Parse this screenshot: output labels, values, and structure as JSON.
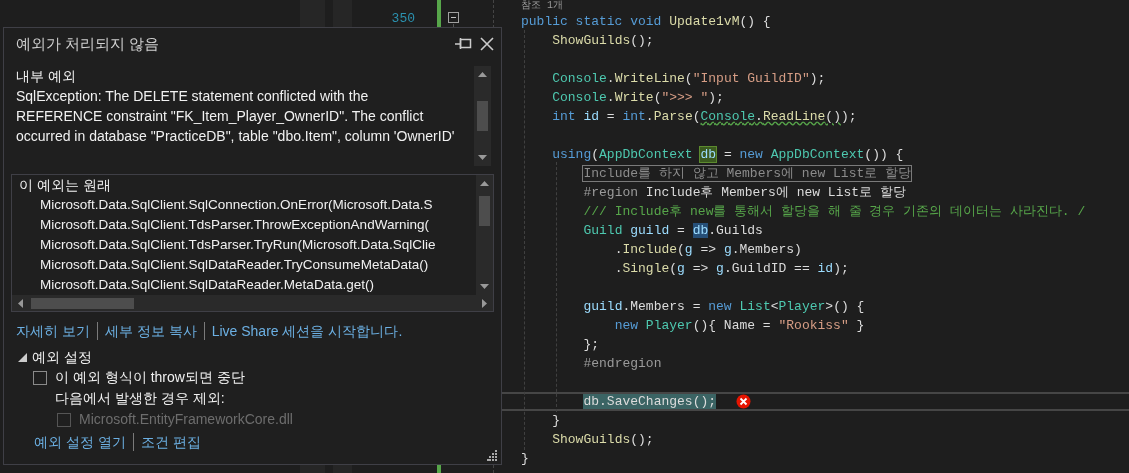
{
  "editor": {
    "line_number": "350",
    "code_lines": [
      {
        "kind": "codelens",
        "text": "참조 1개"
      },
      {
        "kind": "code",
        "tokens": [
          {
            "text": "public static void ",
            "kind": "kw"
          },
          {
            "text": "Update1vM",
            "kind": "method"
          },
          {
            "text": "() {",
            "kind": "plain"
          }
        ]
      },
      {
        "kind": "code",
        "tokens": [
          {
            "text": "    ShowGuilds",
            "kind": "method"
          },
          {
            "text": "();",
            "kind": "plain"
          }
        ]
      },
      {
        "kind": "blank"
      },
      {
        "kind": "code",
        "tokens": [
          {
            "text": "    Console",
            "kind": "type"
          },
          {
            "text": ".",
            "kind": "plain"
          },
          {
            "text": "WriteLine",
            "kind": "method"
          },
          {
            "text": "(",
            "kind": "plain"
          },
          {
            "text": "\"Input GuildID\"",
            "kind": "str"
          },
          {
            "text": ");",
            "kind": "plain"
          }
        ]
      },
      {
        "kind": "code",
        "tokens": [
          {
            "text": "    Console",
            "kind": "type"
          },
          {
            "text": ".",
            "kind": "plain"
          },
          {
            "text": "Write",
            "kind": "method"
          },
          {
            "text": "(",
            "kind": "plain"
          },
          {
            "text": "\">>> \"",
            "kind": "str"
          },
          {
            "text": ");",
            "kind": "plain"
          }
        ]
      },
      {
        "kind": "code",
        "tokens": [
          {
            "text": "    int ",
            "kind": "kw"
          },
          {
            "text": "id",
            "kind": "var"
          },
          {
            "text": " = ",
            "kind": "plain"
          },
          {
            "text": "int",
            "kind": "kw"
          },
          {
            "text": ".",
            "kind": "plain"
          },
          {
            "text": "Parse",
            "kind": "method"
          },
          {
            "text": "(",
            "kind": "plain"
          },
          {
            "text": "Console",
            "kind": "type",
            "squiggle": true
          },
          {
            "text": ".",
            "kind": "plain",
            "squiggle": true
          },
          {
            "text": "ReadLine",
            "kind": "method",
            "squiggle": true
          },
          {
            "text": "()",
            "kind": "plain",
            "squiggle": true
          },
          {
            "text": ");",
            "kind": "plain"
          }
        ]
      },
      {
        "kind": "blank"
      },
      {
        "kind": "code",
        "tokens": [
          {
            "text": "    using",
            "kind": "kw"
          },
          {
            "text": "(",
            "kind": "plain"
          },
          {
            "text": "AppDbContext ",
            "kind": "type"
          },
          {
            "text": "db",
            "kind": "var",
            "write_reference": true
          },
          {
            "text": " = ",
            "kind": "plain"
          },
          {
            "text": "new ",
            "kind": "kw"
          },
          {
            "text": "AppDbContext",
            "kind": "type"
          },
          {
            "text": "()) {",
            "kind": "plain"
          }
        ]
      },
      {
        "kind": "code",
        "tokens": [
          {
            "text": "        Include를 하지 않고 Members에 new List로 할당",
            "kind": "hint"
          }
        ]
      },
      {
        "kind": "code",
        "tokens": [
          {
            "text": "        #region ",
            "kind": "preproc"
          },
          {
            "text": "Include후 Members에 new List로 할당",
            "kind": "plain"
          }
        ]
      },
      {
        "kind": "code",
        "tokens": [
          {
            "text": "        /// Include후 new를 통해서 할당을 해 줄 경우 기존의 데이터는 사라진다. /",
            "kind": "comment"
          }
        ]
      },
      {
        "kind": "code",
        "tokens": [
          {
            "text": "        Guild ",
            "kind": "type"
          },
          {
            "text": "guild",
            "kind": "var"
          },
          {
            "text": " = ",
            "kind": "plain"
          },
          {
            "text": "db",
            "kind": "var",
            "reference": true
          },
          {
            "text": ".Guilds",
            "kind": "plain"
          }
        ]
      },
      {
        "kind": "code",
        "tokens": [
          {
            "text": "            .",
            "kind": "plain"
          },
          {
            "text": "Include",
            "kind": "method"
          },
          {
            "text": "(",
            "kind": "plain"
          },
          {
            "text": "g",
            "kind": "var"
          },
          {
            "text": " => ",
            "kind": "plain"
          },
          {
            "text": "g",
            "kind": "var"
          },
          {
            "text": ".Members)",
            "kind": "plain"
          }
        ]
      },
      {
        "kind": "code",
        "tokens": [
          {
            "text": "            .",
            "kind": "plain"
          },
          {
            "text": "Single",
            "kind": "method"
          },
          {
            "text": "(",
            "kind": "plain"
          },
          {
            "text": "g",
            "kind": "var"
          },
          {
            "text": " => ",
            "kind": "plain"
          },
          {
            "text": "g",
            "kind": "var"
          },
          {
            "text": ".GuildID == ",
            "kind": "plain"
          },
          {
            "text": "id",
            "kind": "var"
          },
          {
            "text": ");",
            "kind": "plain"
          }
        ]
      },
      {
        "kind": "blank"
      },
      {
        "kind": "code",
        "tokens": [
          {
            "text": "        guild",
            "kind": "var"
          },
          {
            "text": ".Members = ",
            "kind": "plain"
          },
          {
            "text": "new ",
            "kind": "kw"
          },
          {
            "text": "List",
            "kind": "type"
          },
          {
            "text": "<",
            "kind": "plain"
          },
          {
            "text": "Player",
            "kind": "type"
          },
          {
            "text": ">() {",
            "kind": "plain"
          }
        ]
      },
      {
        "kind": "code",
        "tokens": [
          {
            "text": "            new ",
            "kind": "kw"
          },
          {
            "text": "Player",
            "kind": "type"
          },
          {
            "text": "(){ Name = ",
            "kind": "plain"
          },
          {
            "text": "\"Rookiss\"",
            "kind": "str"
          },
          {
            "text": " }",
            "kind": "plain"
          }
        ]
      },
      {
        "kind": "code",
        "tokens": [
          {
            "text": "        };",
            "kind": "plain"
          }
        ]
      },
      {
        "kind": "code",
        "tokens": [
          {
            "text": "        #endregion",
            "kind": "preproc"
          }
        ]
      },
      {
        "kind": "blank"
      },
      {
        "kind": "code",
        "current": true,
        "error": true,
        "tokens": [
          {
            "text": "        db",
            "kind": "plain",
            "selected": true
          },
          {
            "text": ".SaveChanges();",
            "kind": "plain",
            "selected": true
          }
        ]
      },
      {
        "kind": "code",
        "tokens": [
          {
            "text": "    }",
            "kind": "plain"
          }
        ]
      },
      {
        "kind": "code",
        "tokens": [
          {
            "text": "    ShowGuilds",
            "kind": "method"
          },
          {
            "text": "();",
            "kind": "plain"
          }
        ]
      },
      {
        "kind": "code",
        "tokens": [
          {
            "text": "}",
            "kind": "plain"
          }
        ]
      }
    ]
  },
  "exception_popup": {
    "title": "예외가 처리되지 않음",
    "inner_exception": {
      "heading": "내부 예외",
      "message": "SqlException: The DELETE statement conflicted with the REFERENCE constraint \"FK_Item_Player_OwnerID\". The conflict occurred in database \"PracticeDB\", table \"dbo.Item\", column 'OwnerID'"
    },
    "stack_trace": {
      "heading": "이 예외는 원래",
      "frames": [
        "Microsoft.Data.SqlClient.SqlConnection.OnError(Microsoft.Data.S",
        "Microsoft.Data.SqlClient.TdsParser.ThrowExceptionAndWarning(",
        "Microsoft.Data.SqlClient.TdsParser.TryRun(Microsoft.Data.SqlClie",
        "Microsoft.Data.SqlClient.SqlDataReader.TryConsumeMetaData()",
        "Microsoft.Data.SqlClient.SqlDataReader.MetaData.get()"
      ]
    },
    "links": [
      "자세히 보기",
      "세부 정보 복사",
      "Live Share 세션을 시작합니다."
    ],
    "settings": {
      "label": "예외 설정",
      "expanded": true,
      "break_option": {
        "label": "이 예외 형식이 throw되면 중단",
        "checked": false
      },
      "except_label": "다음에서 발생한 경우 제외:",
      "modules": [
        {
          "label": "Microsoft.EntityFrameworkCore.dll",
          "checked": false,
          "disabled": true
        }
      ]
    },
    "footer_links": [
      "예외 설정 열기",
      "조건 편집"
    ]
  }
}
